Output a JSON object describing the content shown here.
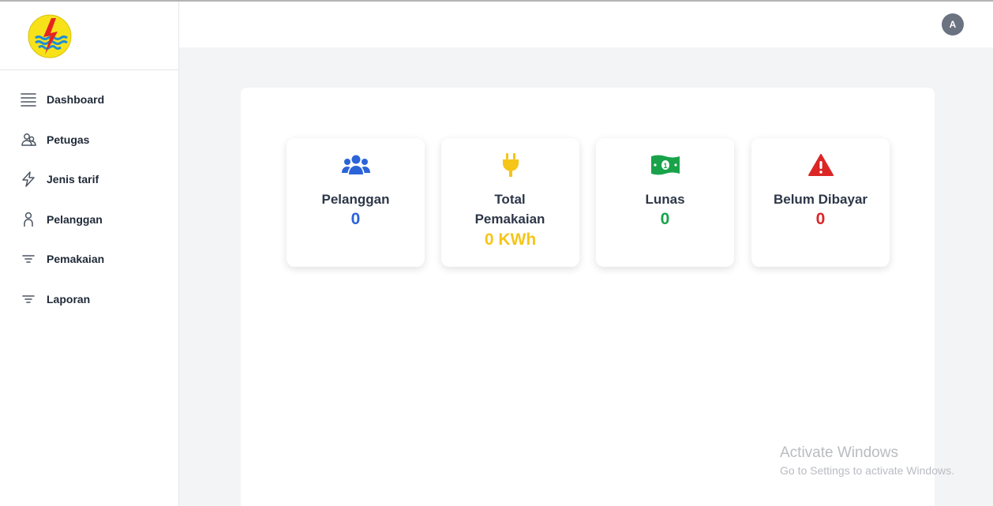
{
  "sidebar": {
    "logo_icon": "pln-lightning-logo-icon",
    "items": [
      {
        "label": "Dashboard",
        "icon": "menu-lines-icon"
      },
      {
        "label": "Petugas",
        "icon": "users-outline-icon"
      },
      {
        "label": "Jenis tarif",
        "icon": "lightning-bolt-icon"
      },
      {
        "label": "Pelanggan",
        "icon": "user-outline-icon"
      },
      {
        "label": "Pemakaian",
        "icon": "filter-lines-icon"
      },
      {
        "label": "Laporan",
        "icon": "filter-lines-icon"
      }
    ]
  },
  "header": {
    "avatar_initial": "A"
  },
  "cards": [
    {
      "title": "Pelanggan",
      "value": "0",
      "color": "#2b63d9",
      "icon": "users-group-icon"
    },
    {
      "title": "Total Pemakaian",
      "value": "0 KWh",
      "color": "#f5c518",
      "icon": "plug-icon"
    },
    {
      "title": "Lunas",
      "value": "0",
      "color": "#18a34a",
      "icon": "money-bill-icon"
    },
    {
      "title": "Belum Dibayar",
      "value": "0",
      "color": "#dc2626",
      "icon": "warning-triangle-icon"
    }
  ],
  "watermark": {
    "line1": "Activate Windows",
    "line2": "Go to Settings to activate Windows."
  }
}
